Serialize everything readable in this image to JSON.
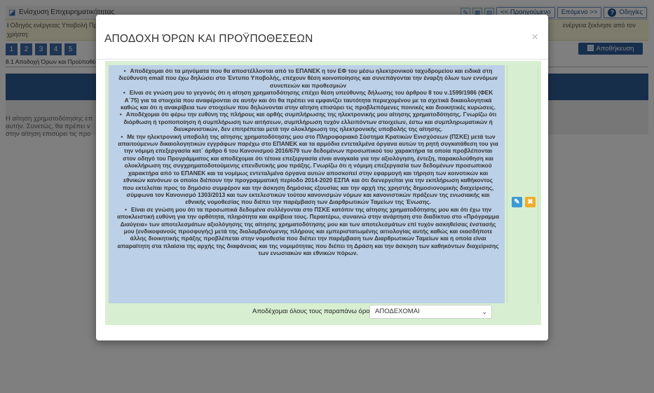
{
  "app": {
    "title": "Ενίσχυση Επιχειρηματικότητας",
    "toolbar": {
      "prev_label": "<< Προηγούμενο",
      "next_label": "Επόμενο >>",
      "help_label": "Οδηγίες"
    },
    "notice": {
      "left_line1": "Οδηγός ενέργειας Υποβολή Πρ",
      "left_line2": "χρήστη:",
      "right_text": "ενέργεια ξεκίνησε από τον"
    },
    "steps": [
      "1",
      "2",
      "3",
      "4",
      "5"
    ],
    "save_label": "Αποθήκευση",
    "breadcrumb": "8.1 Αποδοχή Όρων και Προϋποθέσ",
    "left_text": "Η αίτηση χρηματοδότησης επ αυτήν. Συνετώς, θα πρέπει ν στην αίτηση επισύρει τις προ"
  },
  "modal": {
    "title": "ΑΠΟΔΟΧΗ ΌΡΩΝ ΚΑΙ ΠΡΟΫΠΟΘΕΣΕΩΝ",
    "close_symbol": "×",
    "terms": [
      "Αποδέχομαι ότι τα μηνύματα που θα αποστέλλονται από το ΕΠΑΝΕΚ η τον ΕΦ του μέσω ηλεκτρονικού ταχυδρομείου και ειδικά στη διεύθυνση email που έχω δηλώσει στο Έντυπο Υποβολής, επέχουν θέση κοινοποίησης και συνεπάγονται την έναρξη όλων των εννόμων συνεπειών και προθεσμιών",
      "Είναι σε γνώση μου το γεγονός ότι η αίτηση χρηματοδότησης επέχει θέση υπεύθυνης δήλωσης του άρθρου 8 του ν.1599/1986 (ΦΕΚ Α΄75) για τα στοιχεία που αναφέρονται σε αυτήν και ότι θα πρέπει να εμφανίζει ταυτότητα περιεχομένου με τα σχετικά δικαιολογητικά καθώς και ότι η ανακρίβεια των στοιχείων που δηλώνονται στην αίτηση επισύρει τις προβλεπόμενες ποινικές και διοικητικές κυρώσεις.",
      "Αποδέχομαι ότι φέρω την ευθύνη της πλήρους και ορθής συμπλήρωσης της ηλεκτρονικής μου αίτησης χρηματοδότησης. Γνωρίζω ότι διόρθωση ή τροποποίηση ή συμπλήρωση των αιτήσεων, συμπλήρωση τυχόν ελλειπόντων στοιχείων, έστω και συμπληρωματικών ή διευκρινιστικών, δεν επιτρέπεται μετά την ολοκλήρωση της ηλεκτρονικής υποβολής της αίτησης.",
      "Με την ηλεκτρονική υποβολή της αίτησης χρηματοδότησης μου στο Πληροφοριακό Σύστημα Κρατικών Ενισχύσεων (ΠΣΚΕ) μετά των απαιτούμενων δικαιολογητικών εγγράφων παρέχω στο ΕΠΑΝΕΚ και τα αρμόδια εντεταλμένα όργανα αυτών τη ρητή συγκατάθεση του για την νόμιμη επεξεργασία κατ΄ άρθρο 6 του Κανονισμού 2016/679 των δεδομένων προσωπικού του χαρακτήρα τα οποία προβλέπονται στον οδηγό του Προγράμματος και αποδέχομαι ότι τέτοια επεξεργασία είναι αναγκαία για την αξιολόγηση, έντεξη, παρακολούθηση και ολοκλήρωση της συγχρηματοδοτούμενης επενδυτικής μου πράξης. Γνωρίζω ότι η νόμιμη επεξεργασία των δεδομένων προσωπικού χαρακτήρα από το ΕΠΑΝΕΚ και τα νομίμως εντεταλμένα όργανα αυτών αποσκοπεί στην εφαρμογή και τήρηση των κοινοτικών και εθνικών κανόνων οι οποίοι διέπουν την προγραμματική περίοδο 2014-2020 ΕΣΠΑ και ότι διενεργείται για την εκπλήρωση καθήκοντος που εκτελείται προς το δημόσιο συμφέρον και την άσκηση δημόσιας εξουσίας και την αρχή της χρηστής δημοσιονομικής διαχείρισης, σύμφωνα τον Κανονισμό 1303/2013 και των εκτελεστικών τούτου κανονισμών νόμων και κανονιστικών πράξεων της ενωσιακής και εθνικής νομοθεσίας που διέπει την παρέμβαση των Διαρθρωτικών Ταμείων της Ένωσης.",
      "Είναι σε γνώση μου ότι τα προσωπικά δεδομένα συλλέγονται στο ΠΣΚΕ κατόπιν της αίτησης χρηματοδότησης μου και ότι έχω την αποκλειστική ευθύνη για την ορθότητα, πληρότητα και ακρίβεια τους. Περαιτέρω, συναινώ στην ανάρτηση στο διαδίκτυο στο «Πρόγραμμα Διαύγεια» των αποτελεσμάτων αξιολόγησης της αίτησης χρηματοδότησης μου και των αποτελεσμάτων επί τυχόν ασκηθείσας ένστασής μου (ενδικοφανούς προσφυγής) μετά της διαλαμβανόμενης πλήρους και εμπεριστατωμένης αιτιολογίας αυτής καθώς και οιασδήποτε άλλης διοικητικής πράξης προβλέπεται στην νομοθεσία που διέπει την παρέμβαση των Διαρθρωτικών Ταμείων και η οποία είναι απαραίτητη στα πλαίσια της αρχής της διαφάνειας και της νομιμότητας που διέπει τη Δράση και την άσκηση των καθηκόντων διαχείρισης των ενωσιακών και εθνικών πόρων."
    ],
    "accept_label": "Αποδέχομαι όλους τους παραπάνω όρους",
    "accept_value": "ΑΠΟΔΕΧΟΜΑΙ"
  }
}
